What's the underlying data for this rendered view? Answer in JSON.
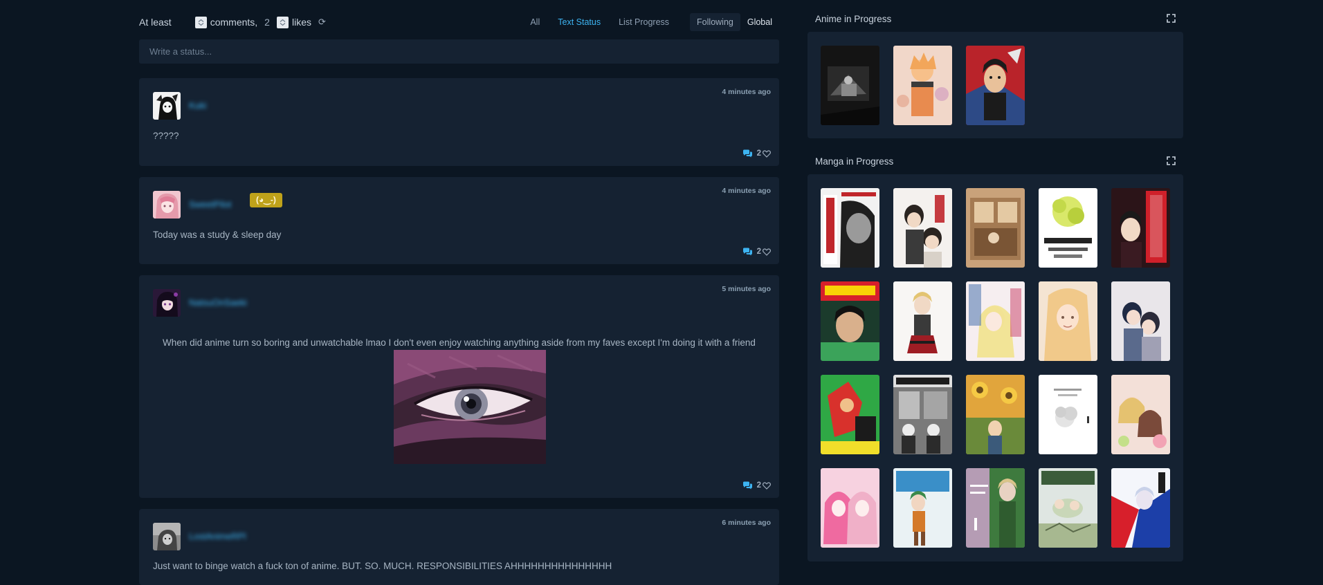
{
  "filter": {
    "at_least_label": "At least",
    "comments_label": "comments,",
    "likes_count": "2",
    "likes_label": "likes",
    "refresh_icon": "refresh-icon",
    "tabs": [
      {
        "label": "All",
        "active": false
      },
      {
        "label": "Text Status",
        "active": true
      },
      {
        "label": "List Progress",
        "active": false
      }
    ],
    "scope": {
      "following": "Following",
      "global": "Global",
      "selected": "Following"
    }
  },
  "composer": {
    "placeholder": "Write a status..."
  },
  "feed": [
    {
      "username": "Kuki",
      "time": "4 minutes ago",
      "text": "?????",
      "likes": "2"
    },
    {
      "username": "SweetPilot",
      "badge": "(◕‿-)",
      "time": "4 minutes ago",
      "text": "Today was a study & sleep day",
      "likes": "2"
    },
    {
      "username": "NatsuOnSaeki",
      "time": "5 minutes ago",
      "text": "When did anime turn so boring and unwatchable lmao I don't even enjoy watching anything aside from my faves except I'm doing it with a friend",
      "likes": "2"
    },
    {
      "username": "LostAnimeRPl",
      "time": "6 minutes ago",
      "text": "Just want to binge watch a fuck ton of anime. BUT. SO. MUCH. RESPONSIBILITIES AHHHHHHHHHHHHHHH"
    }
  ],
  "sidebar": {
    "anime_title": "Anime in Progress",
    "manga_title": "Manga in Progress",
    "anime_covers": 3,
    "manga_covers": 20
  },
  "colors": {
    "background": "#0b1622",
    "panel": "#152232",
    "accent": "#3db4f2",
    "text": "#9fadbd",
    "badge": "#bfa21a"
  }
}
